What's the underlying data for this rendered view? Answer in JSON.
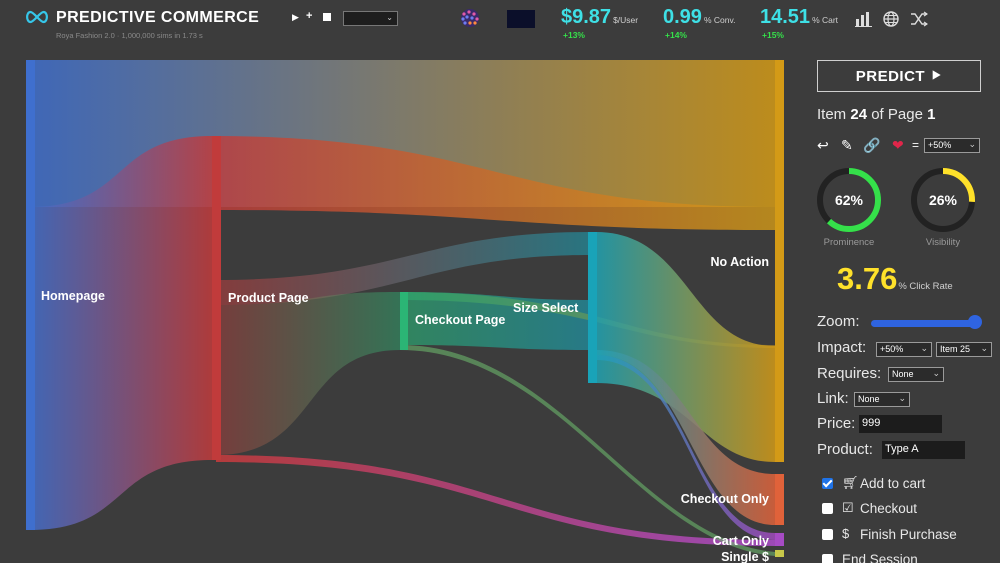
{
  "header": {
    "brand": "PREDICTIVE COMMERCE",
    "subtitle": "Roya Fashion 2.0 · 1,000,000 sims in 1.73 s",
    "controls": {
      "play_icon": "play-icon",
      "add_label": "+",
      "stop_icon": "stop-icon",
      "selected": ""
    },
    "metrics": [
      {
        "value": "$9.87",
        "unit": "$/User",
        "delta": "+13%"
      },
      {
        "value": "0.99",
        "unit": "% Conv.",
        "delta": "+14%"
      },
      {
        "value": "14.51",
        "unit": "% Cart",
        "delta": "+15%"
      }
    ],
    "icons": [
      "bar-chart-icon",
      "globe-icon",
      "shuffle-icon"
    ]
  },
  "sankey": {
    "nodes": [
      {
        "id": "homepage",
        "label": "Homepage",
        "color": "#3f6fce"
      },
      {
        "id": "product",
        "label": "Product Page",
        "color": "#c13b3b"
      },
      {
        "id": "checkout_page",
        "label": "Checkout Page",
        "color": "#2bb575"
      },
      {
        "id": "size",
        "label": "Size Select",
        "color": "#19a3b8"
      },
      {
        "id": "no_action",
        "label": "No Action",
        "color": "#d39a17"
      },
      {
        "id": "checkout_only",
        "label": "Checkout Only",
        "color": "#e0623a"
      },
      {
        "id": "cart_only",
        "label": "Cart Only",
        "color": "#a64bc4"
      },
      {
        "id": "single",
        "label": "Single $",
        "color": "#c8c84a"
      }
    ]
  },
  "panel": {
    "predict_label": "PREDICT ⯈",
    "item_prefix": "Item",
    "item_number": "24",
    "item_middle": "of Page",
    "page_number": "1",
    "equals": "=",
    "heart_select": "+50%",
    "prominence_value": "62%",
    "prominence_fraction": 0.62,
    "prominence_label": "Prominence",
    "prominence_color": "#35e04a",
    "visibility_value": "26%",
    "visibility_fraction": 0.26,
    "visibility_label": "Visibility",
    "visibility_color": "#ffe12a",
    "click_rate": "3.76",
    "click_rate_unit": "% Click Rate",
    "zoom_label": "Zoom:",
    "zoom_level": 1.0,
    "impact_label": "Impact:",
    "impact_value": "+50%",
    "impact_item": "Item 25",
    "requires_label": "Requires:",
    "requires_value": "None",
    "link_label": "Link:",
    "link_value": "None",
    "price_label": "Price:",
    "price_value": "999",
    "product_label": "Product:",
    "product_value": "Type A",
    "checks": [
      {
        "label": "Add to cart",
        "checked": true
      },
      {
        "label": "Checkout",
        "checked": false
      },
      {
        "label": "Finish Purchase",
        "checked": false
      },
      {
        "label": "End Session",
        "checked": false
      }
    ]
  }
}
